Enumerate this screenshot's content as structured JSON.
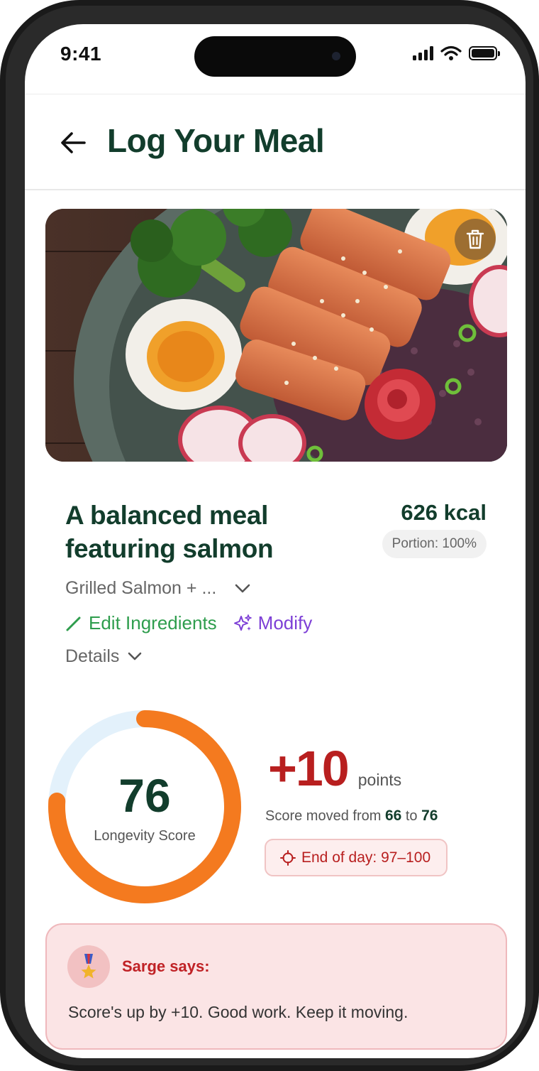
{
  "status_bar": {
    "time": "9:41"
  },
  "header": {
    "title": "Log Your Meal"
  },
  "meal": {
    "title": "A balanced meal featuring salmon",
    "kcal": "626 kcal",
    "portion": "Portion: 100%",
    "ingredients_summary": "Grilled Salmon + ...",
    "edit_label": "Edit Ingredients",
    "modify_label": "Modify",
    "details_label": "Details"
  },
  "score": {
    "value": "76",
    "label": "Longevity Score",
    "progress": 0.76,
    "points_value": "+10",
    "points_label": "points",
    "moved_prefix": "Score moved from ",
    "from": "66",
    "moved_mid": " to ",
    "to": "76",
    "end_of_day": "End of day: 97–100"
  },
  "sarge": {
    "title": "Sarge says:",
    "message": "Score's up by +10. Good work. Keep it moving."
  },
  "colors": {
    "brand_green": "#123d2c",
    "edit_green": "#2e9d4d",
    "modify_purple": "#7d3fd6",
    "score_orange": "#f47a1f",
    "ring_track": "#e3f1fb",
    "points_red": "#b81f1f",
    "sarge_bg": "#fbe4e5"
  },
  "icons": {
    "back": "arrow-left-icon",
    "delete": "trash-icon",
    "ingredients": "chevron-down-icon",
    "edit": "pencil-icon",
    "modify": "sparkles-icon",
    "details": "chevron-down-icon",
    "end_of_day": "target-icon",
    "sarge": "medal-icon"
  }
}
